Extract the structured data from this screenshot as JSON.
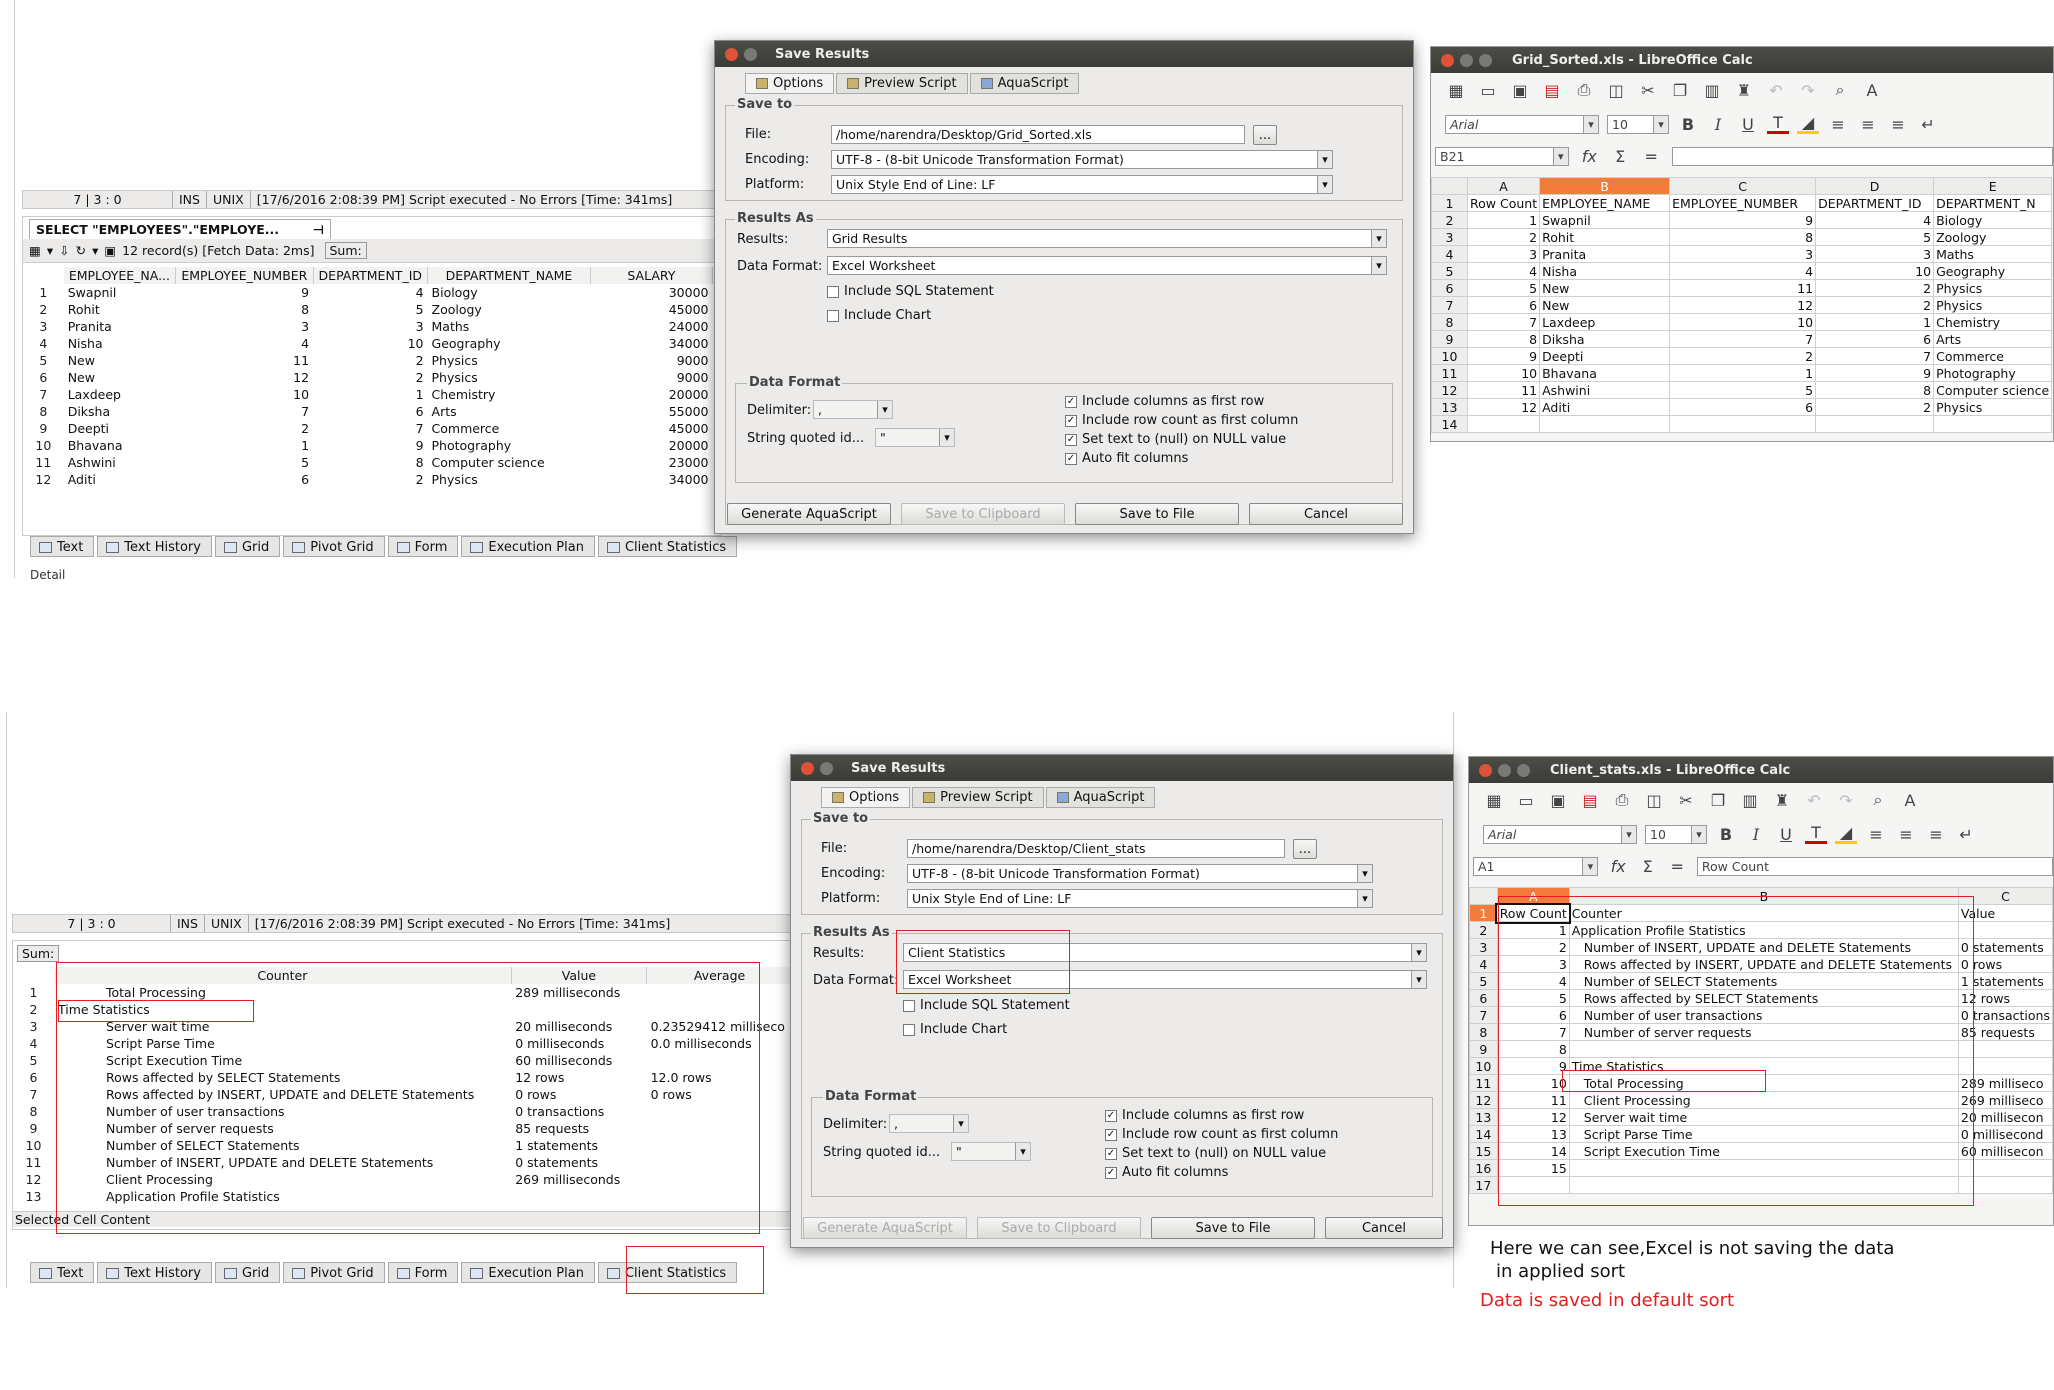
{
  "top": {
    "status": {
      "pos": "7 | 3 : 0",
      "ins": "INS",
      "unix": "UNIX",
      "message": "[17/6/2016 2:08:39 PM] Script executed - No Errors [Time: 341ms]"
    },
    "result_tab": "SELECT \"EMPLOYEES\".\"EMPLOYE...",
    "records": "12 record(s) [Fetch Data: 2ms]",
    "sum_label": "Sum:",
    "grid_headers": [
      "EMPLOYEE_NA...",
      "EMPLOYEE_NUMBER",
      "DEPARTMENT_ID",
      "DEPARTMENT_NAME",
      "SALARY"
    ],
    "grid_rows": [
      [
        "1",
        "Swapnil",
        "9",
        "4",
        "Biology",
        "30000"
      ],
      [
        "2",
        "Rohit",
        "8",
        "5",
        "Zoology",
        "45000"
      ],
      [
        "3",
        "Pranita",
        "3",
        "3",
        "Maths",
        "24000"
      ],
      [
        "4",
        "Nisha",
        "4",
        "10",
        "Geography",
        "34000"
      ],
      [
        "5",
        "New",
        "11",
        "2",
        "Physics",
        "9000"
      ],
      [
        "6",
        "New",
        "12",
        "2",
        "Physics",
        "9000"
      ],
      [
        "7",
        "Laxdeep",
        "10",
        "1",
        "Chemistry",
        "20000"
      ],
      [
        "8",
        "Diksha",
        "7",
        "6",
        "Arts",
        "55000"
      ],
      [
        "9",
        "Deepti",
        "2",
        "7",
        "Commerce",
        "45000"
      ],
      [
        "10",
        "Bhavana",
        "1",
        "9",
        "Photography",
        "20000"
      ],
      [
        "11",
        "Ashwini",
        "5",
        "8",
        "Computer science",
        "23000"
      ],
      [
        "12",
        "Aditi",
        "6",
        "2",
        "Physics",
        "34000"
      ]
    ],
    "bottom_tabs": [
      "Text",
      "Text History",
      "Grid",
      "Pivot Grid",
      "Form",
      "Execution Plan",
      "Client Statistics"
    ],
    "detail_label": "Detail",
    "dialog": {
      "title": "Save Results",
      "tabs": [
        "Options",
        "Preview Script",
        "AquaScript"
      ],
      "save_to": "Save to",
      "file_label": "File:",
      "file_value": "/home/narendra/Desktop/Grid_Sorted.xls",
      "browse": "...",
      "encoding_label": "Encoding:",
      "encoding_value": "UTF-8 - (8-bit Unicode Transformation Format)",
      "platform_label": "Platform:",
      "platform_value": "Unix Style End of Line: LF",
      "results_as": "Results As",
      "results_label": "Results:",
      "results_value": "Grid Results",
      "format_label": "Data Format:",
      "format_value": "Excel Worksheet",
      "include_sql": "Include SQL Statement",
      "include_chart": "Include Chart",
      "data_format": "Data Format",
      "delimiter": "Delimiter:",
      "delimiter_value": ",",
      "string_quoted": "String quoted id...",
      "string_quoted_value": "\"",
      "opt1": "Include columns as first row",
      "opt2": "Include row count as first column",
      "opt3": "Set text to (null) on NULL value",
      "opt4": "Auto fit columns",
      "btn_generate": "Generate AquaScript",
      "btn_clipboard": "Save to Clipboard",
      "btn_file": "Save to File",
      "btn_cancel": "Cancel"
    },
    "calc": {
      "title": "Grid_Sorted.xls - LibreOffice Calc",
      "font": "Arial",
      "size": "10",
      "cellref": "B21",
      "formula": "",
      "cols": [
        "A",
        "B",
        "C",
        "D",
        "E"
      ],
      "rows": [
        [
          "1",
          "Row Count",
          "EMPLOYEE_NAME",
          "EMPLOYEE_NUMBER",
          "DEPARTMENT_ID",
          "DEPARTMENT_N"
        ],
        [
          "2",
          "1",
          "Swapnil",
          "9",
          "4",
          "Biology"
        ],
        [
          "3",
          "2",
          "Rohit",
          "8",
          "5",
          "Zoology"
        ],
        [
          "4",
          "3",
          "Pranita",
          "3",
          "3",
          "Maths"
        ],
        [
          "5",
          "4",
          "Nisha",
          "4",
          "10",
          "Geography"
        ],
        [
          "6",
          "5",
          "New",
          "11",
          "2",
          "Physics"
        ],
        [
          "7",
          "6",
          "New",
          "12",
          "2",
          "Physics"
        ],
        [
          "8",
          "7",
          "Laxdeep",
          "10",
          "1",
          "Chemistry"
        ],
        [
          "9",
          "8",
          "Diksha",
          "7",
          "6",
          "Arts"
        ],
        [
          "10",
          "9",
          "Deepti",
          "2",
          "7",
          "Commerce"
        ],
        [
          "11",
          "10",
          "Bhavana",
          "1",
          "9",
          "Photography"
        ],
        [
          "12",
          "11",
          "Ashwini",
          "5",
          "8",
          "Computer science"
        ],
        [
          "13",
          "12",
          "Aditi",
          "6",
          "2",
          "Physics"
        ],
        [
          "14",
          "",
          "",
          "",
          "",
          ""
        ]
      ]
    }
  },
  "bottom": {
    "status": {
      "pos": "7 | 3 : 0",
      "ins": "INS",
      "unix": "UNIX",
      "message": "[17/6/2016 2:08:39 PM] Script executed - No Errors [Time: 341ms]"
    },
    "sum_label": "Sum:",
    "grid_headers": [
      "Counter",
      "Value",
      "Average"
    ],
    "grid_rows": [
      [
        "1",
        "Total Processing",
        "289 milliseconds",
        ""
      ],
      [
        "2",
        "Time Statistics",
        "",
        ""
      ],
      [
        "3",
        "Server wait time",
        "20 milliseconds",
        "0.23529412 milliseco"
      ],
      [
        "4",
        "Script Parse Time",
        "0 milliseconds",
        "0.0 milliseconds"
      ],
      [
        "5",
        "Script Execution Time",
        "60 milliseconds",
        ""
      ],
      [
        "6",
        "Rows affected by SELECT Statements",
        "12 rows",
        "12.0 rows"
      ],
      [
        "7",
        "Rows affected by INSERT, UPDATE and DELETE Statements",
        "0 rows",
        "0 rows"
      ],
      [
        "8",
        "Number of user transactions",
        "0 transactions",
        ""
      ],
      [
        "9",
        "Number of server requests",
        "85 requests",
        ""
      ],
      [
        "10",
        "Number of SELECT Statements",
        "1 statements",
        ""
      ],
      [
        "11",
        "Number of INSERT, UPDATE and DELETE Statements",
        "0 statements",
        ""
      ],
      [
        "12",
        "Client Processing",
        "269 milliseconds",
        ""
      ],
      [
        "13",
        "Application Profile Statistics",
        "",
        ""
      ]
    ],
    "selected_cell": "Selected Cell Content",
    "bottom_tabs": [
      "Text",
      "Text History",
      "Grid",
      "Pivot Grid",
      "Form",
      "Execution Plan",
      "Client Statistics"
    ],
    "dialog": {
      "title": "Save Results",
      "tabs": [
        "Options",
        "Preview Script",
        "AquaScript"
      ],
      "save_to": "Save to",
      "file_label": "File:",
      "file_value": "/home/narendra/Desktop/Client_stats",
      "browse": "...",
      "encoding_label": "Encoding:",
      "encoding_value": "UTF-8 - (8-bit Unicode Transformation Format)",
      "platform_label": "Platform:",
      "platform_value": "Unix Style End of Line: LF",
      "results_as": "Results As",
      "results_label": "Results:",
      "results_value": "Client Statistics",
      "format_label": "Data Format:",
      "format_value": "Excel Worksheet",
      "include_sql": "Include SQL Statement",
      "include_chart": "Include Chart",
      "data_format": "Data Format",
      "delimiter": "Delimiter:",
      "delimiter_value": ",",
      "string_quoted": "String quoted id...",
      "string_quoted_value": "\"",
      "opt1": "Include columns as first row",
      "opt2": "Include row count as first column",
      "opt3": "Set text to (null) on NULL value",
      "opt4": "Auto fit columns",
      "btn_generate": "Generate AquaScript",
      "btn_clipboard": "Save to Clipboard",
      "btn_file": "Save to File",
      "btn_cancel": "Cancel"
    },
    "calc": {
      "title": "Client_stats.xls - LibreOffice Calc",
      "font": "Arial",
      "size": "10",
      "cellref": "A1",
      "formula": "Row Count",
      "cols": [
        "A",
        "B",
        "C"
      ],
      "rows": [
        [
          "1",
          "Row Count",
          "Counter",
          "Value"
        ],
        [
          "2",
          "1",
          "Application Profile Statistics",
          ""
        ],
        [
          "3",
          "2",
          "Number of INSERT, UPDATE and DELETE Statements",
          "0 statements"
        ],
        [
          "4",
          "3",
          "Rows affected by INSERT, UPDATE and DELETE Statements",
          "0 rows"
        ],
        [
          "5",
          "4",
          "Number of SELECT Statements",
          "1 statements"
        ],
        [
          "6",
          "5",
          "Rows affected by SELECT Statements",
          "12 rows"
        ],
        [
          "7",
          "6",
          "Number of user transactions",
          "0 transactions"
        ],
        [
          "8",
          "7",
          "Number of server requests",
          "85 requests"
        ],
        [
          "9",
          "8",
          "",
          ""
        ],
        [
          "10",
          "9",
          "Time Statistics",
          ""
        ],
        [
          "11",
          "10",
          "Total Processing",
          "289 milliseco"
        ],
        [
          "12",
          "11",
          "Client Processing",
          "269 milliseco"
        ],
        [
          "13",
          "12",
          "Server wait time",
          "20 millisecon"
        ],
        [
          "14",
          "13",
          "Script Parse Time",
          "0 millisecond"
        ],
        [
          "15",
          "14",
          "Script Execution Time",
          "60 millisecon"
        ],
        [
          "16",
          "15",
          "",
          ""
        ],
        [
          "17",
          "",
          "",
          ""
        ]
      ]
    }
  },
  "notes": {
    "line1": "Here we can see,Excel is not saving the data",
    "line2": "in applied sort",
    "line3": "Data is saved in default sort",
    "line3_color": "#e21e1e"
  }
}
